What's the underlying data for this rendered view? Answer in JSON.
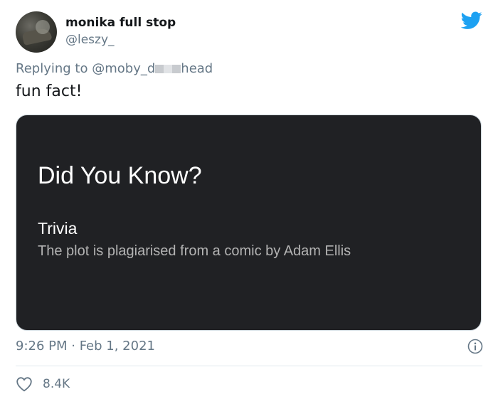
{
  "author": {
    "display_name": "monika full stop",
    "handle": "@leszy_"
  },
  "reply": {
    "prefix": "Replying to",
    "mention_start": "@moby_d",
    "mention_end": "head"
  },
  "tweet": {
    "text": "fun fact!",
    "timestamp": "9:26 PM · Feb 1, 2021",
    "likes": "8.4K"
  },
  "card": {
    "title": "Did You Know?",
    "subtitle": "Trivia",
    "body": "The plot is plagiarised from a comic by Adam Ellis"
  },
  "icons": {
    "brand": "twitter-bird-icon",
    "info": "info-icon",
    "like": "heart-icon"
  },
  "colors": {
    "twitter_blue": "#1DA1F2",
    "secondary_text": "#657786",
    "card_background": "#202124"
  }
}
